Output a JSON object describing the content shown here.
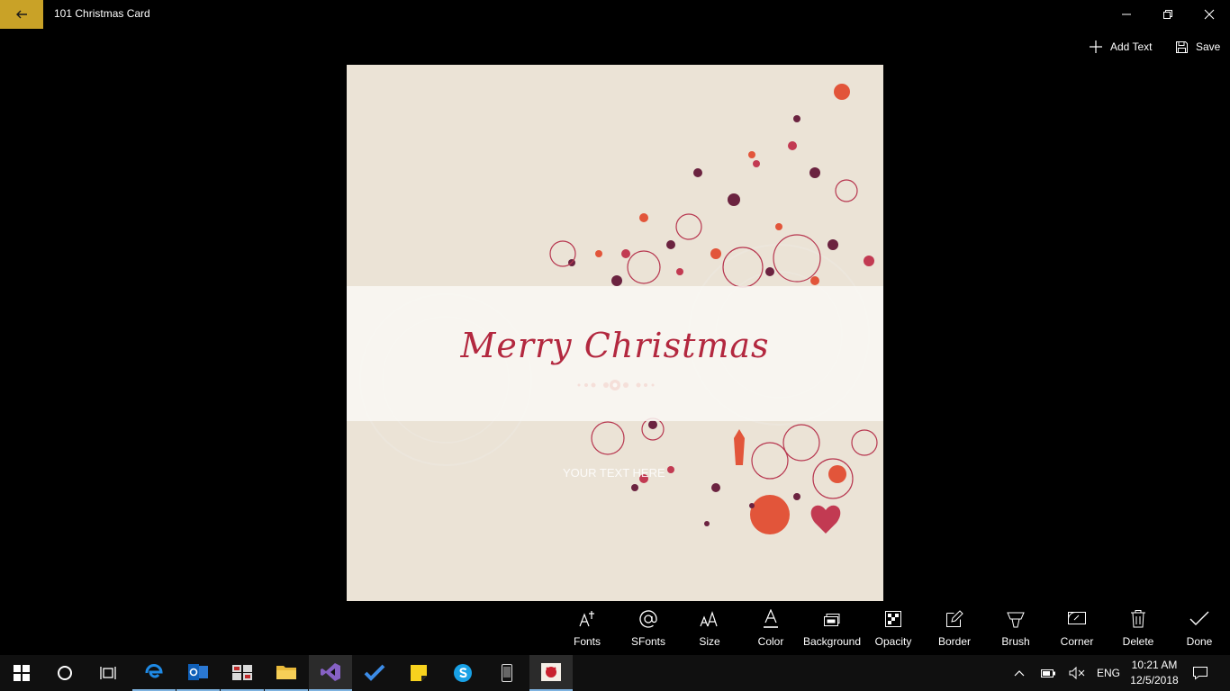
{
  "window": {
    "title": "101 Christmas Card",
    "accent": "#c9a227"
  },
  "commands": {
    "add_text": "Add Text",
    "save": "Save"
  },
  "card": {
    "headline": "Merry Christmas",
    "placeholder_text": "YOUR TEXT HERE",
    "background": "#ebe3d6",
    "headline_color": "#b3283f"
  },
  "toolbar": {
    "items": [
      {
        "label": "Fonts",
        "icon": "fonts-icon"
      },
      {
        "label": "SFonts",
        "icon": "at-sign-icon"
      },
      {
        "label": "Size",
        "icon": "font-size-icon"
      },
      {
        "label": "Color",
        "icon": "font-color-icon"
      },
      {
        "label": "Background",
        "icon": "background-icon"
      },
      {
        "label": "Opacity",
        "icon": "opacity-icon"
      },
      {
        "label": "Border",
        "icon": "border-edit-icon"
      },
      {
        "label": "Brush",
        "icon": "brush-icon"
      },
      {
        "label": "Corner",
        "icon": "corner-icon"
      },
      {
        "label": "Delete",
        "icon": "trash-icon"
      },
      {
        "label": "Done",
        "icon": "checkmark-icon"
      }
    ]
  },
  "taskbar": {
    "apps": [
      "start-icon",
      "cortana-icon",
      "task-view-icon",
      "edge-icon",
      "outlook-icon",
      "photos-app-icon",
      "file-explorer-icon",
      "visual-studio-icon",
      "todo-icon",
      "sticky-notes-icon",
      "skype-icon",
      "phone-icon",
      "christmas-card-app-icon"
    ],
    "language": "ENG",
    "time": "10:21 AM",
    "date": "12/5/2018"
  }
}
